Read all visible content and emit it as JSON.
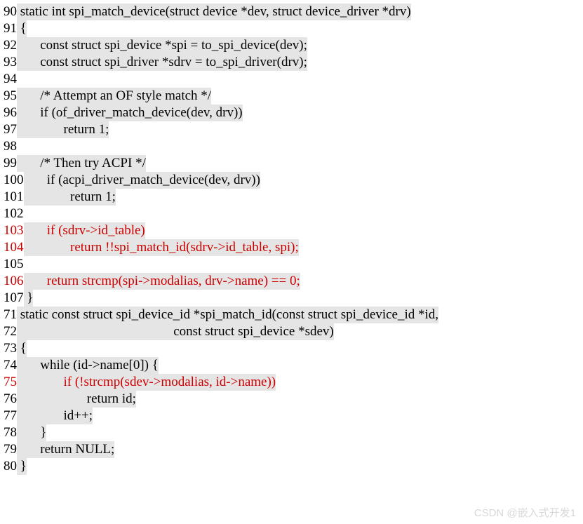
{
  "lines": [
    {
      "no": "90",
      "code": " static int spi_match_device(struct device *dev, struct device_driver *drv)",
      "hl": true,
      "red": false
    },
    {
      "no": "91",
      "code": " {",
      "hl": true,
      "red": false
    },
    {
      "no": "92",
      "code": "       const struct spi_device *spi = to_spi_device(dev);",
      "hl": true,
      "red": false
    },
    {
      "no": "93",
      "code": "       const struct spi_driver *sdrv = to_spi_driver(drv);",
      "hl": true,
      "red": false
    },
    {
      "no": "94",
      "code": "",
      "hl": true,
      "red": false
    },
    {
      "no": "95",
      "code": "       /* Attempt an OF style match */",
      "hl": true,
      "red": false
    },
    {
      "no": "96",
      "code": "       if (of_driver_match_device(dev, drv))",
      "hl": true,
      "red": false
    },
    {
      "no": "97",
      "code": "              return 1;",
      "hl": true,
      "red": false
    },
    {
      "no": "98",
      "code": "",
      "hl": true,
      "red": false
    },
    {
      "no": "99",
      "code": "       /* Then try ACPI */",
      "hl": true,
      "red": false
    },
    {
      "no": "100",
      "code": "       if (acpi_driver_match_device(dev, drv))",
      "hl": true,
      "red": false
    },
    {
      "no": "101",
      "code": "              return 1;",
      "hl": true,
      "red": false
    },
    {
      "no": "102",
      "code": "",
      "hl": true,
      "red": false
    },
    {
      "no": "103",
      "code": "       if (sdrv->id_table)",
      "hl": true,
      "red": true
    },
    {
      "no": "104",
      "code": "              return !!spi_match_id(sdrv->id_table, spi);",
      "hl": true,
      "red": true
    },
    {
      "no": "105",
      "code": "",
      "hl": true,
      "red": false
    },
    {
      "no": "106",
      "code": "       return strcmp(spi->modalias, drv->name) == 0;",
      "hl": true,
      "red": true
    },
    {
      "no": "107",
      "code": " }",
      "hl": true,
      "red": false
    },
    {
      "no": "71",
      "code": " static const struct spi_device_id *spi_match_id(const struct spi_device_id *id,",
      "hl": true,
      "red": false
    },
    {
      "no": "72",
      "code": "                                               const struct spi_device *sdev)",
      "hl": true,
      "red": false
    },
    {
      "no": "73",
      "code": " {",
      "hl": true,
      "red": false
    },
    {
      "no": "74",
      "code": "       while (id->name[0]) {",
      "hl": true,
      "red": false
    },
    {
      "no": "75",
      "code": "              if (!strcmp(sdev->modalias, id->name))",
      "hl": true,
      "red": true
    },
    {
      "no": "76",
      "code": "                     return id;",
      "hl": true,
      "red": false
    },
    {
      "no": "77",
      "code": "              id++;",
      "hl": true,
      "red": false
    },
    {
      "no": "78",
      "code": "       }",
      "hl": true,
      "red": false
    },
    {
      "no": "79",
      "code": "       return NULL;",
      "hl": true,
      "red": false
    },
    {
      "no": "80",
      "code": " }",
      "hl": true,
      "red": false
    }
  ],
  "watermark": "CSDN @嵌入式开发1"
}
